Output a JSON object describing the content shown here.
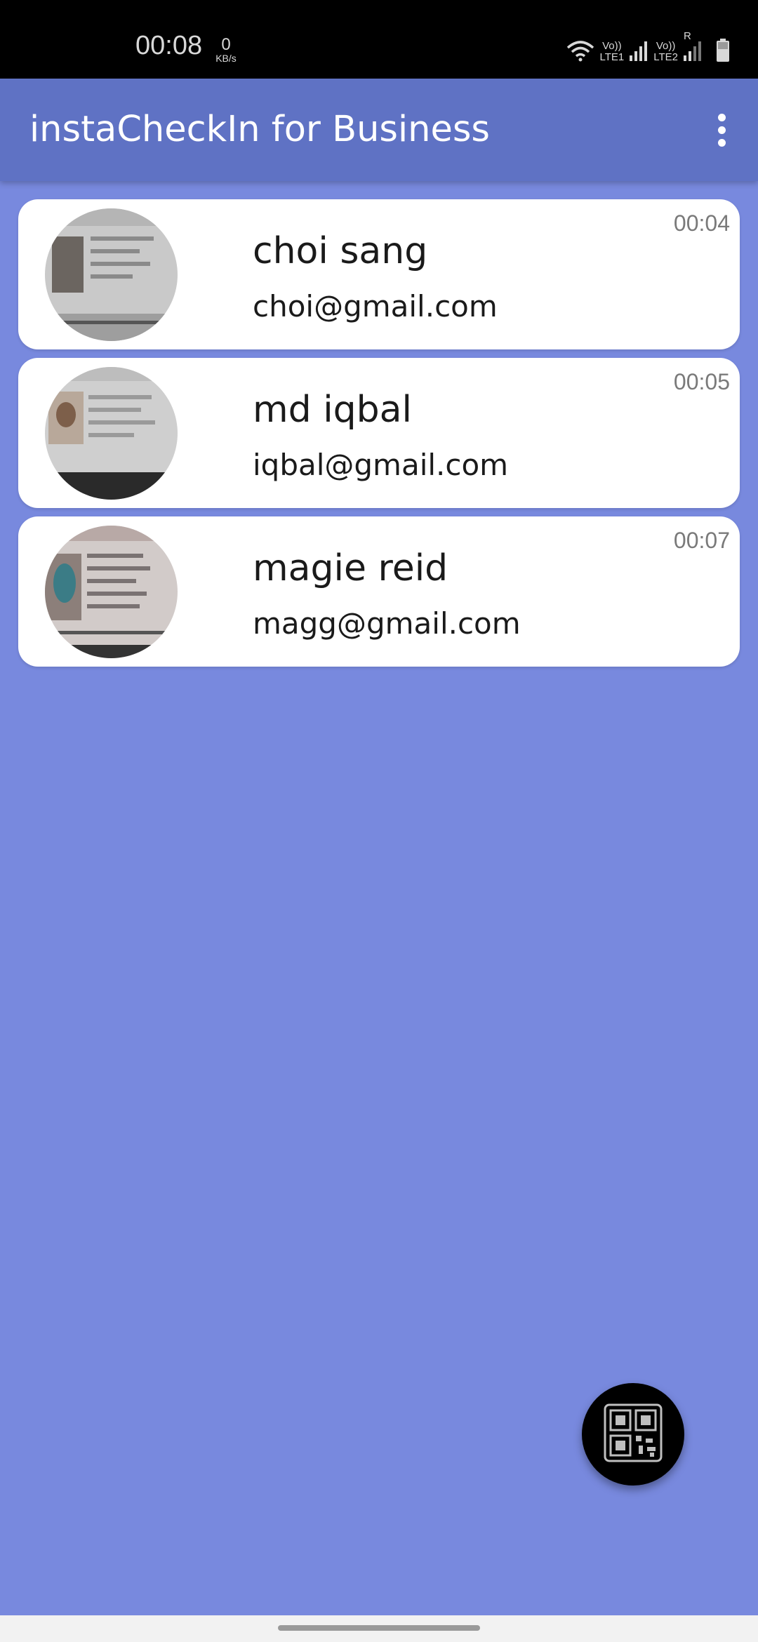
{
  "status_bar": {
    "time": "00:08",
    "net_speed_value": "0",
    "net_speed_unit": "KB/s",
    "sim1_label_top": "Vo))",
    "sim1_label_bottom": "LTE1",
    "sim2_label_top": "Vo))",
    "sim2_label_bottom": "LTE2",
    "roaming": "R",
    "icons": [
      "wifi-icon",
      "signal-icon",
      "battery-icon"
    ]
  },
  "app_bar": {
    "title": "instaCheckIn for Business",
    "menu_icon": "more-vert-icon"
  },
  "checkins": [
    {
      "name": "choi sang",
      "email": "choi@gmail.com",
      "time": "00:04",
      "avatar": "passport-photo"
    },
    {
      "name": "md iqbal",
      "email": "iqbal@gmail.com",
      "time": "00:05",
      "avatar": "passport-photo"
    },
    {
      "name": "magie reid",
      "email": "magg@gmail.com",
      "time": "00:07",
      "avatar": "passport-photo"
    }
  ],
  "fab": {
    "icon": "qr-code-icon"
  },
  "colors": {
    "background": "#7889de",
    "app_bar": "#5f72c4",
    "card": "#ffffff",
    "fab": "#000000"
  }
}
